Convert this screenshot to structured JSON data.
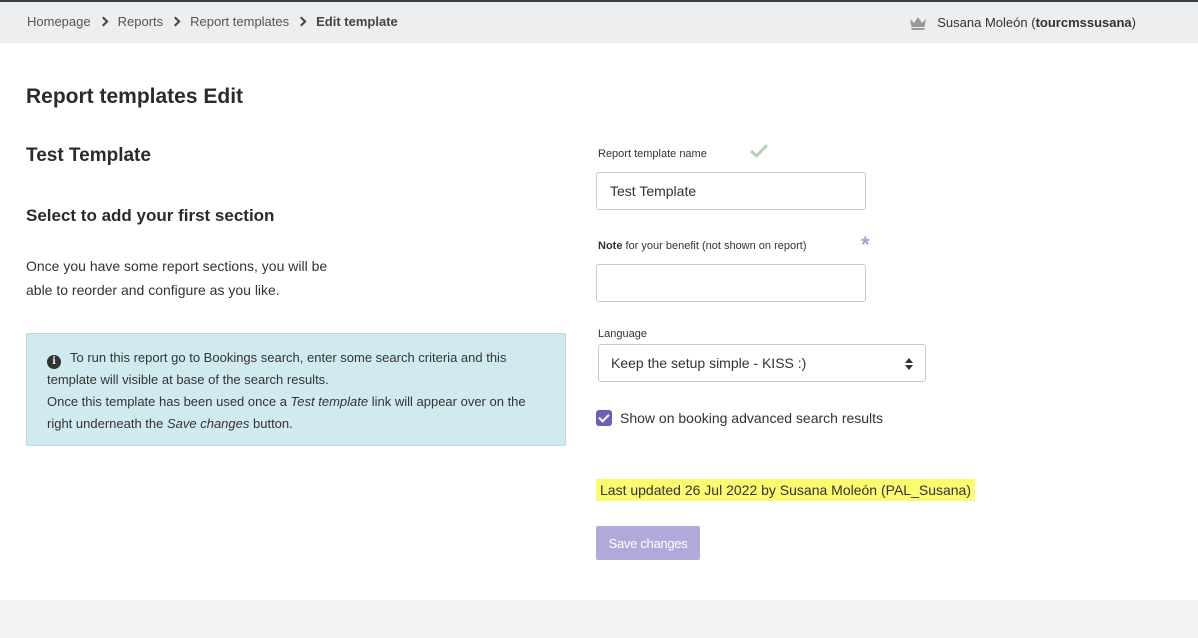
{
  "breadcrumb": {
    "items": [
      "Homepage",
      "Reports",
      "Report templates"
    ],
    "current": "Edit template"
  },
  "user": {
    "name": "Susana Moleón",
    "handle": "tourcmssusana",
    "icon": "crown-icon"
  },
  "page": {
    "title": "Report templates Edit",
    "template_name": "Test Template",
    "section_heading": "Select to add your first section",
    "help_lines": [
      "Once you have some report sections, you will be",
      "able to reorder and configure as you like."
    ]
  },
  "info": {
    "icon": "info-icon",
    "line1": "To run this report go to Bookings search, enter some search criteria and this",
    "line2": "template will visible at base of the search results.",
    "line3_pre": "Once this template has been used once a ",
    "line3_em": "Test template",
    "line3_post": " link will appear over on the",
    "line4_pre": "right underneath the ",
    "line4_em": "Save changes",
    "line4_post": " button."
  },
  "form": {
    "name_label": "Report template name",
    "name_value": "Test Template",
    "note_label_bold": "Note",
    "note_label_rest": " for your benefit (not shown on report)",
    "note_value": "",
    "language_label": "Language",
    "language_value": "Keep the setup simple - KISS :)",
    "show_label": "Show on booking advanced search results",
    "show_checked": true,
    "last_updated": "Last updated 26 Jul 2022 by Susana Moleón (PAL_Susana)",
    "save_label": "Save changes"
  },
  "colors": {
    "accent": "#6e5fb8",
    "button": "#b2a8d9",
    "info_bg": "#d1eaf0",
    "highlight": "#fbfb6f",
    "check": "#b7cfb9"
  }
}
